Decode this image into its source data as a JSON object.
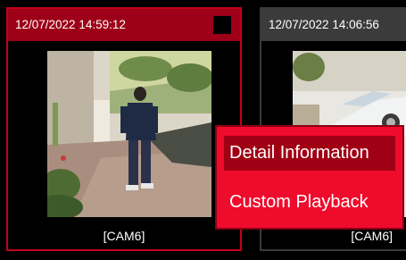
{
  "cards": [
    {
      "timestamp": "12/07/2022 14:59:12",
      "camera": "[CAM6]"
    },
    {
      "timestamp": "12/07/2022 14:06:56",
      "camera": "[CAM6]"
    }
  ],
  "context_menu": {
    "items": [
      "Detail Information",
      "Custom Playback"
    ]
  },
  "colors": {
    "accent": "#c4001a",
    "menu_bg": "#ef0b2c",
    "menu_highlight": "#a00014"
  },
  "icons": {
    "header_square": "selection-square-icon"
  }
}
